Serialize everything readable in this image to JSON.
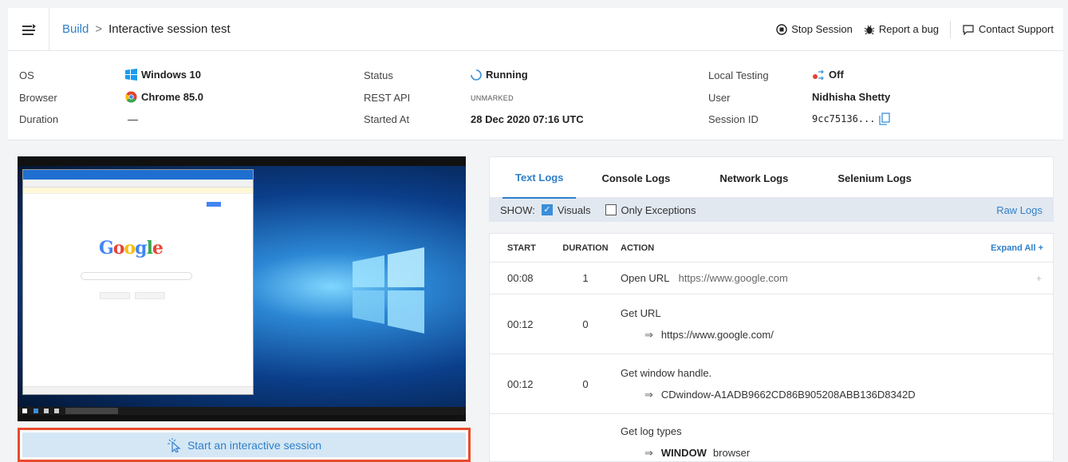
{
  "header": {
    "breadcrumb_root": "Build",
    "separator": ">",
    "page_title": "Interactive session test",
    "actions": {
      "stop": "Stop Session",
      "report": "Report a bug",
      "contact": "Contact Support"
    }
  },
  "info": {
    "os_label": "OS",
    "os_value": "Windows 10",
    "browser_label": "Browser",
    "browser_value": "Chrome 85.0",
    "duration_label": "Duration",
    "duration_value": "—",
    "status_label": "Status",
    "status_value": "Running",
    "api_label": "REST API",
    "api_value": "UNMARKED",
    "started_label": "Started At",
    "started_value": "28 Dec 2020 07:16 UTC",
    "local_label": "Local Testing",
    "local_value": "Off",
    "user_label": "User",
    "user_value": "Nidhisha Shetty",
    "session_label": "Session ID",
    "session_value": "9cc75136..."
  },
  "video": {
    "start_button": "Start an interactive session"
  },
  "logs": {
    "tabs": [
      "Text Logs",
      "Console Logs",
      "Network Logs",
      "Selenium Logs"
    ],
    "show_label": "SHOW:",
    "visuals_label": "Visuals",
    "exceptions_label": "Only Exceptions",
    "raw_logs": "Raw Logs",
    "columns": {
      "start": "START",
      "duration": "DURATION",
      "action": "ACTION"
    },
    "expand_all": "Expand All +",
    "rows": [
      {
        "start": "00:08",
        "duration": "1",
        "action": "Open URL",
        "detail": "https://www.google.com"
      },
      {
        "start": "00:12",
        "duration": "0",
        "action": "Get URL",
        "detail": "https://www.google.com/"
      },
      {
        "start": "00:12",
        "duration": "0",
        "action": "Get window handle.",
        "detail": "CDwindow-A1ADB9662CD86B905208ABB136D8342D"
      },
      {
        "start": "",
        "duration": "",
        "action": "Get log types",
        "keyword": "WINDOW",
        "detail": "browser"
      }
    ]
  },
  "colors": {
    "accent": "#2f80c9",
    "highlight_border": "#e84b2e"
  }
}
